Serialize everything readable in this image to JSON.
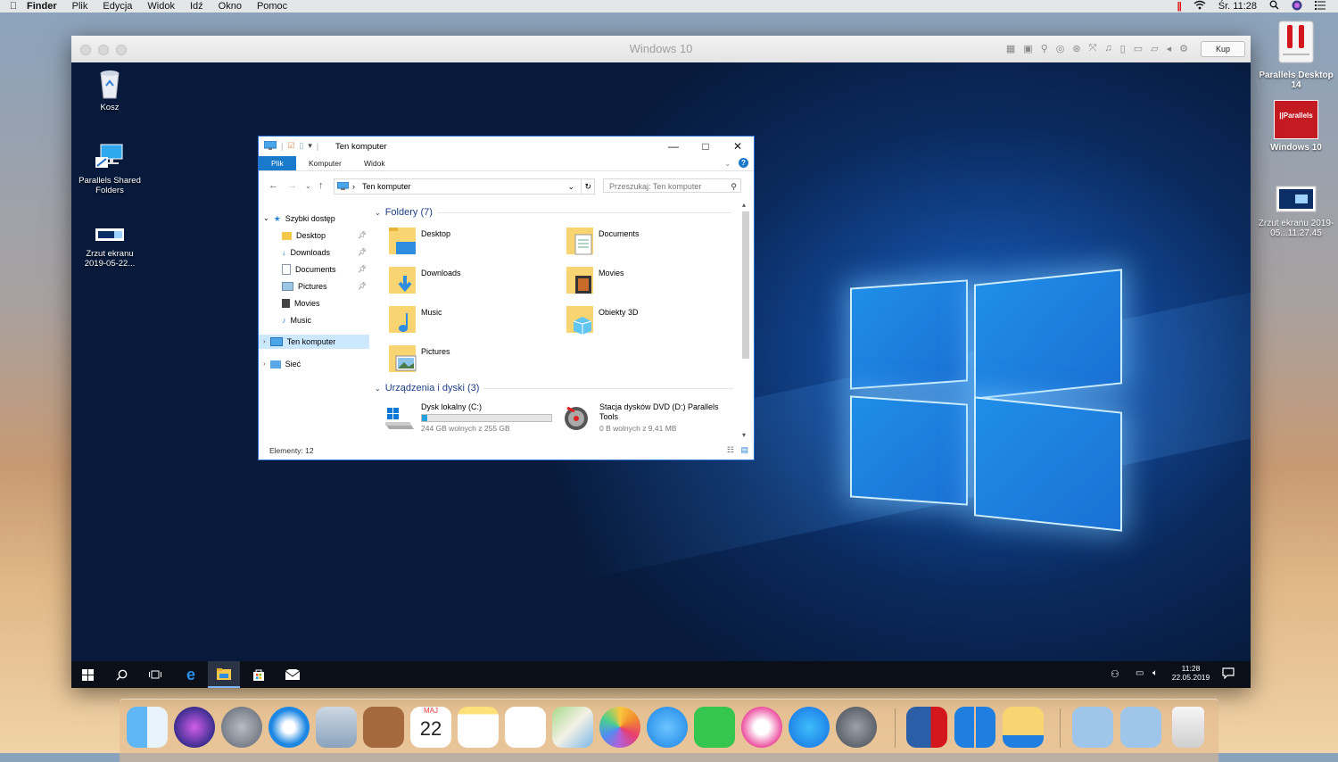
{
  "menubar": {
    "items": [
      "Finder",
      "Plik",
      "Edycja",
      "Widok",
      "Idź",
      "Okno",
      "Pomoc"
    ],
    "clock": "Śr. 11:28"
  },
  "mac_desktop": {
    "icons": [
      {
        "label": "Parallels Desktop 14"
      },
      {
        "label": "Windows 10",
        "badge": "||Parallels"
      },
      {
        "label": "Zrzut ekranu 2019-05...11.27.45"
      }
    ]
  },
  "vm_window": {
    "title": "Windows 10",
    "buy_button": "Kup"
  },
  "win_desktop": {
    "icons": [
      {
        "label": "Kosz"
      },
      {
        "label": "Parallels Shared Folders"
      },
      {
        "label": "Zrzut ekranu 2019-05-22..."
      }
    ]
  },
  "explorer": {
    "title": "Ten komputer",
    "ribbon_tabs": [
      "Plik",
      "Komputer",
      "Widok"
    ],
    "address": "Ten komputer",
    "search_placeholder": "Przeszukaj: Ten komputer",
    "nav": {
      "quick_access": "Szybki dostęp",
      "items": [
        "Desktop",
        "Downloads",
        "Documents",
        "Pictures",
        "Movies",
        "Music"
      ],
      "this_pc": "Ten komputer",
      "network": "Sieć"
    },
    "folders_header": "Foldery (7)",
    "folders": [
      "Desktop",
      "Documents",
      "Downloads",
      "Movies",
      "Music",
      "Obiekty 3D",
      "Pictures"
    ],
    "devices_header": "Urządzenia i dyski (3)",
    "drives": [
      {
        "name": "Dysk lokalny (C:)",
        "free": "244 GB wolnych z 255 GB",
        "used_fraction": 0.04
      },
      {
        "name": "Stacja dysków DVD (D:) Parallels Tools",
        "free": "0 B wolnych z 9,41 MB"
      }
    ],
    "status": "Elementy: 12"
  },
  "taskbar": {
    "time": "11:28",
    "date": "22.05.2019"
  },
  "dock": {
    "calendar_month": "MAJ",
    "calendar_day": "22"
  }
}
